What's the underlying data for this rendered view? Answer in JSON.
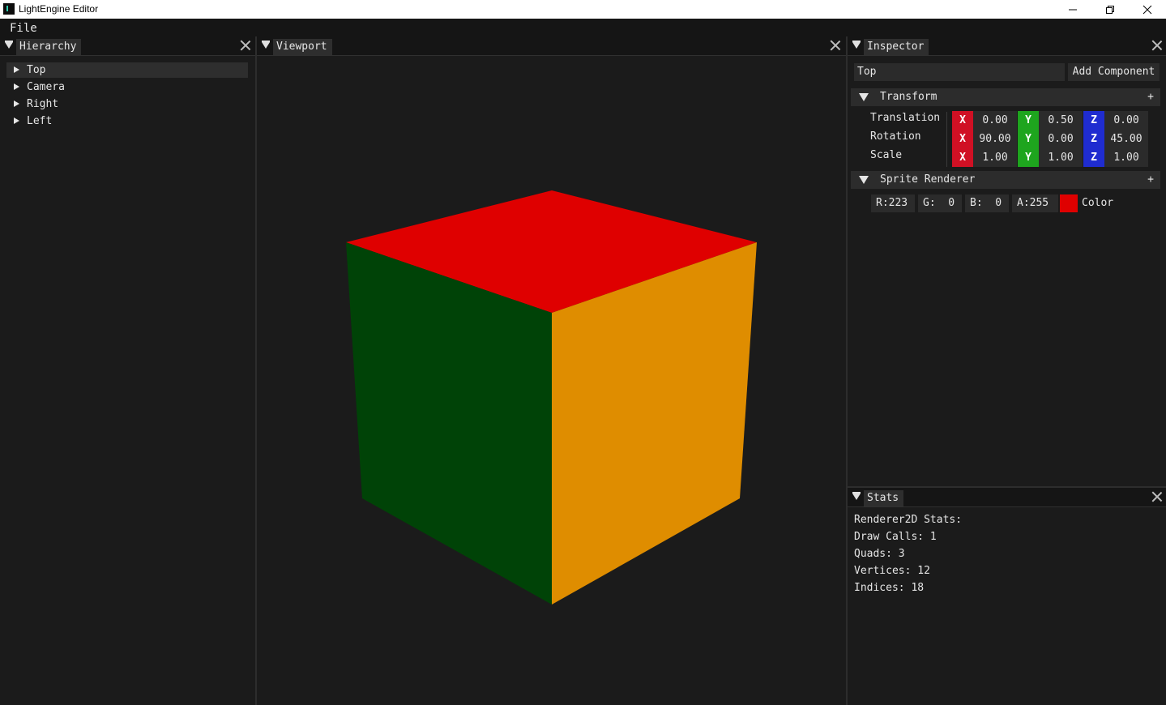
{
  "window": {
    "title": "LightEngine Editor",
    "minimize": "—",
    "restore": "❐",
    "close": "✕"
  },
  "menu": {
    "file": "File"
  },
  "hierarchy": {
    "tab": "Hierarchy",
    "items": [
      {
        "label": "Top"
      },
      {
        "label": "Camera"
      },
      {
        "label": "Right"
      },
      {
        "label": "Left"
      }
    ]
  },
  "viewport": {
    "tab": "Viewport",
    "cube_colors": {
      "top": "#DF0000",
      "left": "#004307",
      "right": "#DF8D00"
    }
  },
  "inspector": {
    "tab": "Inspector",
    "name_value": "Top",
    "add_component": "Add Component",
    "transform": {
      "title": "Transform",
      "plus": "+",
      "rows": [
        {
          "label": "Translation",
          "x": "0.00",
          "y": "0.50",
          "z": "0.00"
        },
        {
          "label": "Rotation",
          "x": "90.00",
          "y": "0.00",
          "z": "45.00"
        },
        {
          "label": "Scale",
          "x": "1.00",
          "y": "1.00",
          "z": "1.00"
        }
      ],
      "axis_x": "X",
      "axis_y": "Y",
      "axis_z": "Z"
    },
    "sprite_renderer": {
      "title": "Sprite Renderer",
      "plus": "+",
      "r": "R:223",
      "g": "G:  0",
      "b": "B:  0",
      "a": "A:255",
      "swatch": "#DF0000",
      "color_label": "Color"
    }
  },
  "stats": {
    "tab": "Stats",
    "lines": [
      "Renderer2D Stats:",
      "Draw Calls: 1",
      "Quads: 3",
      "Vertices: 12",
      "Indices: 18"
    ]
  }
}
